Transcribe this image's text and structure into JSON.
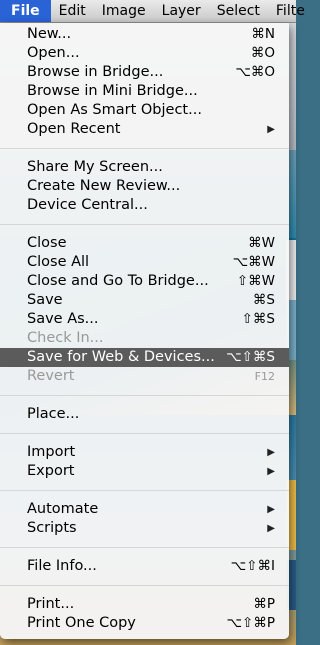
{
  "menubar": {
    "file": "File",
    "edit": "Edit",
    "image": "Image",
    "layer": "Layer",
    "select": "Select",
    "filter": "Filte"
  },
  "file_menu": {
    "new": {
      "label": "New...",
      "shortcut": "⌘N"
    },
    "open": {
      "label": "Open...",
      "shortcut": "⌘O"
    },
    "browse_bridge": {
      "label": "Browse in Bridge...",
      "shortcut": "⌥⌘O"
    },
    "browse_mini_bridge": {
      "label": "Browse in Mini Bridge..."
    },
    "open_smart_object": {
      "label": "Open As Smart Object..."
    },
    "open_recent": {
      "label": "Open Recent",
      "submenu_icon": "▶"
    },
    "share_screen": {
      "label": "Share My Screen..."
    },
    "create_review": {
      "label": "Create New Review..."
    },
    "device_central": {
      "label": "Device Central..."
    },
    "close": {
      "label": "Close",
      "shortcut": "⌘W"
    },
    "close_all": {
      "label": "Close All",
      "shortcut": "⌥⌘W"
    },
    "close_go_bridge": {
      "label": "Close and Go To Bridge...",
      "shortcut": "⇧⌘W"
    },
    "save": {
      "label": "Save",
      "shortcut": "⌘S"
    },
    "save_as": {
      "label": "Save As...",
      "shortcut": "⇧⌘S"
    },
    "check_in": {
      "label": "Check In..."
    },
    "save_web": {
      "label": "Save for Web & Devices...",
      "shortcut": "⌥⇧⌘S"
    },
    "revert": {
      "label": "Revert",
      "shortcut": "F12"
    },
    "place": {
      "label": "Place..."
    },
    "import": {
      "label": "Import",
      "submenu_icon": "▶"
    },
    "export": {
      "label": "Export",
      "submenu_icon": "▶"
    },
    "automate": {
      "label": "Automate",
      "submenu_icon": "▶"
    },
    "scripts": {
      "label": "Scripts",
      "submenu_icon": "▶"
    },
    "file_info": {
      "label": "File Info...",
      "shortcut": "⌥⇧⌘I"
    },
    "print": {
      "label": "Print...",
      "shortcut": "⌘P"
    },
    "print_one": {
      "label": "Print One Copy",
      "shortcut": "⌥⇧⌘P"
    }
  }
}
